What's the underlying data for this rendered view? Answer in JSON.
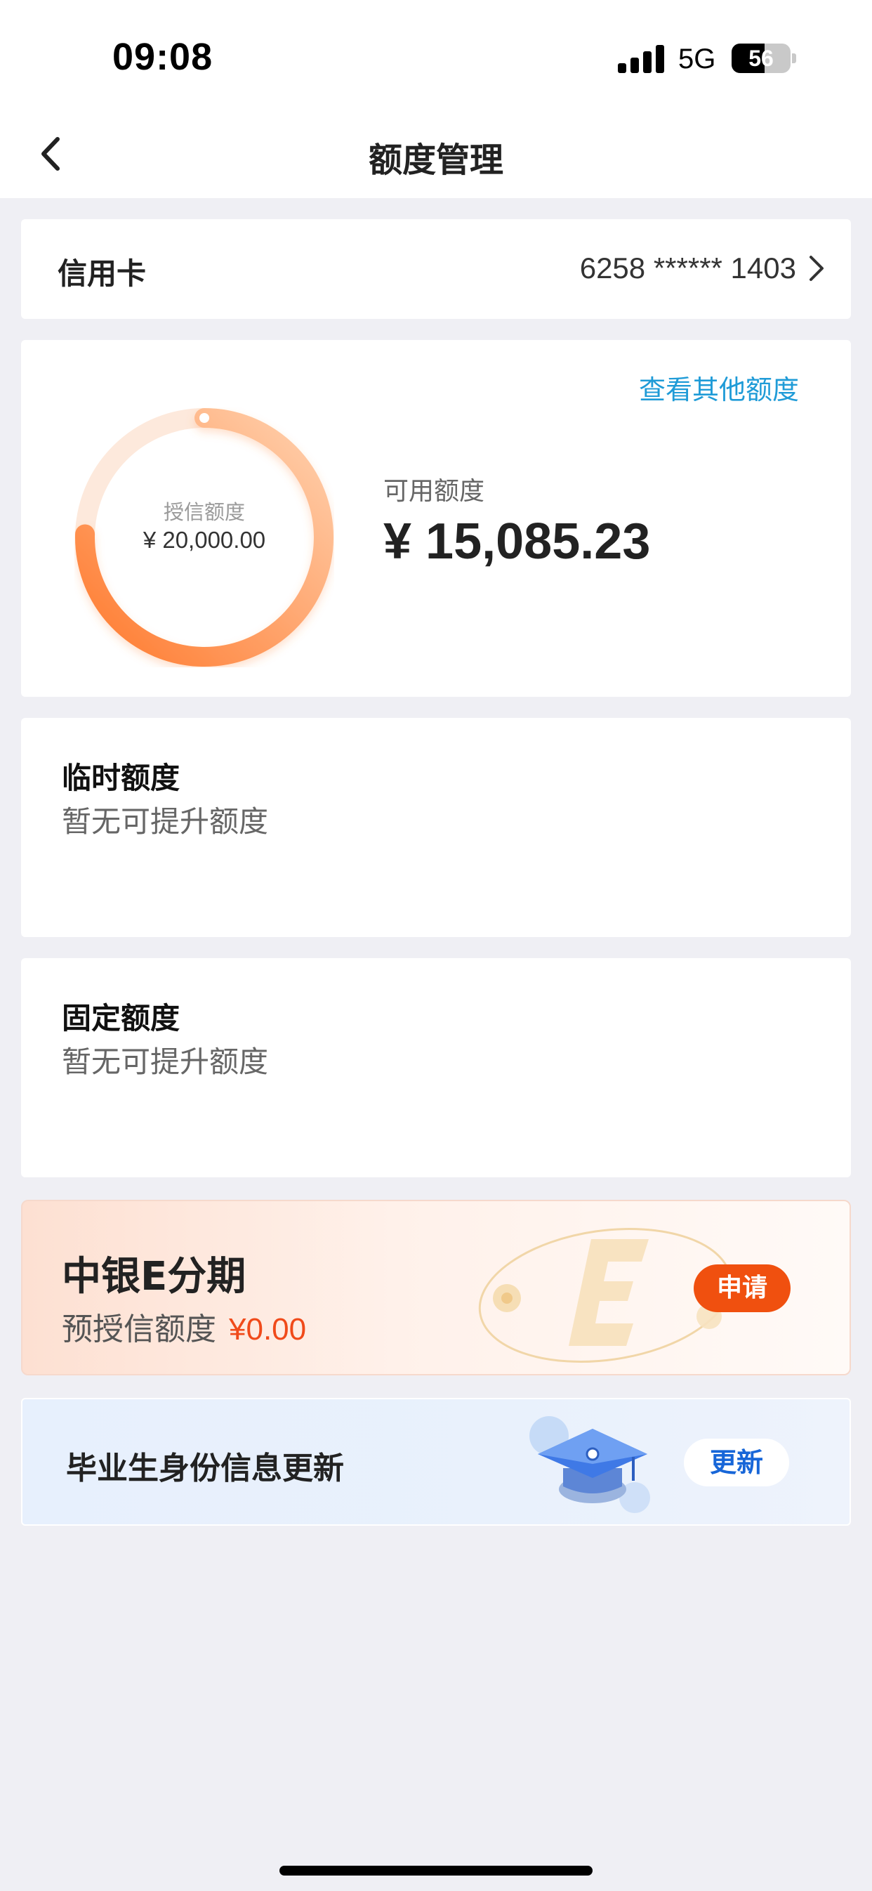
{
  "status_bar": {
    "time": "09:08",
    "network": "5G",
    "battery_level": "56",
    "battery_fraction": 0.56
  },
  "navbar": {
    "title": "额度管理",
    "back_icon": "chevron-left-icon"
  },
  "card_row": {
    "label": "信用卡",
    "card_number": "6258 ****** 1403",
    "chevron_icon": "chevron-right-icon"
  },
  "quota": {
    "other_link": "查看其他额度",
    "credit_label": "授信额度",
    "credit_amount": "¥ 20,000.00",
    "available_label": "可用额度",
    "available_amount": "¥ 15,085.23",
    "credit_value": 20000.0,
    "available_value": 15085.23,
    "ring_colors": {
      "start": "#ff7a2e",
      "end": "#ffd2b0",
      "track": "#fde9dc"
    }
  },
  "temporary": {
    "title": "临时额度",
    "subtitle": "暂无可提升额度"
  },
  "fixed": {
    "title": "固定额度",
    "subtitle": "暂无可提升额度"
  },
  "promo": {
    "title": "中银E分期",
    "sub_label": "预授信额度",
    "sub_amount": "¥0.00",
    "button": "申请",
    "accent": "#f0500f"
  },
  "graduate": {
    "title": "毕业生身份信息更新",
    "button": "更新",
    "icon": "graduation-cap-icon",
    "accent": "#1766d8"
  }
}
